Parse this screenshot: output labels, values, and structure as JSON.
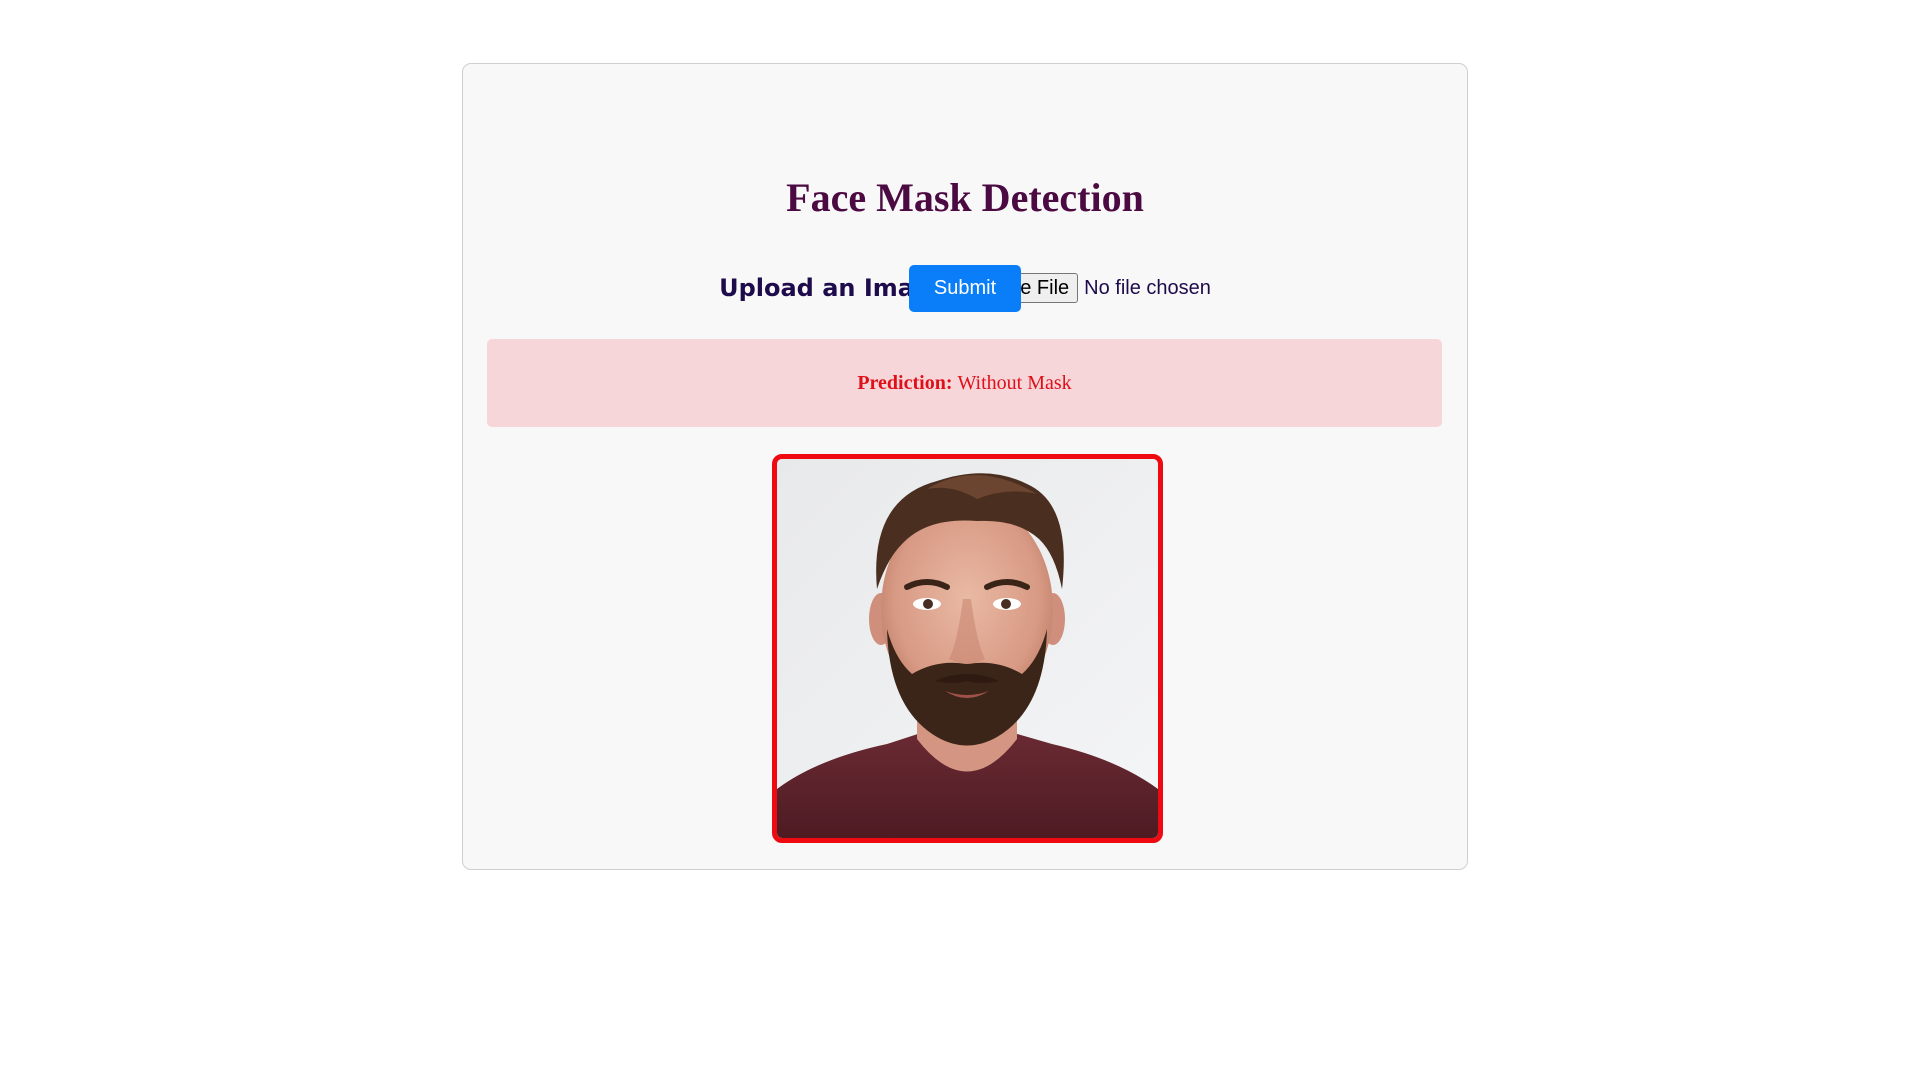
{
  "page": {
    "title": "Face Mask Detection"
  },
  "upload": {
    "label": "Upload an Image",
    "choose_button_label": "Choose File",
    "file_status": "No file chosen"
  },
  "submit": {
    "label": "Submit"
  },
  "prediction": {
    "label": "Prediction:",
    "value": "Without Mask"
  },
  "image": {
    "subject": "portrait of a bearded man in a maroon t-shirt",
    "border_color": "#ee0a10"
  },
  "colors": {
    "title": "#4b0a42",
    "submit_button": "#0a7df8",
    "prediction_bg": "#f7d6d9",
    "prediction_text": "#e0101a"
  }
}
